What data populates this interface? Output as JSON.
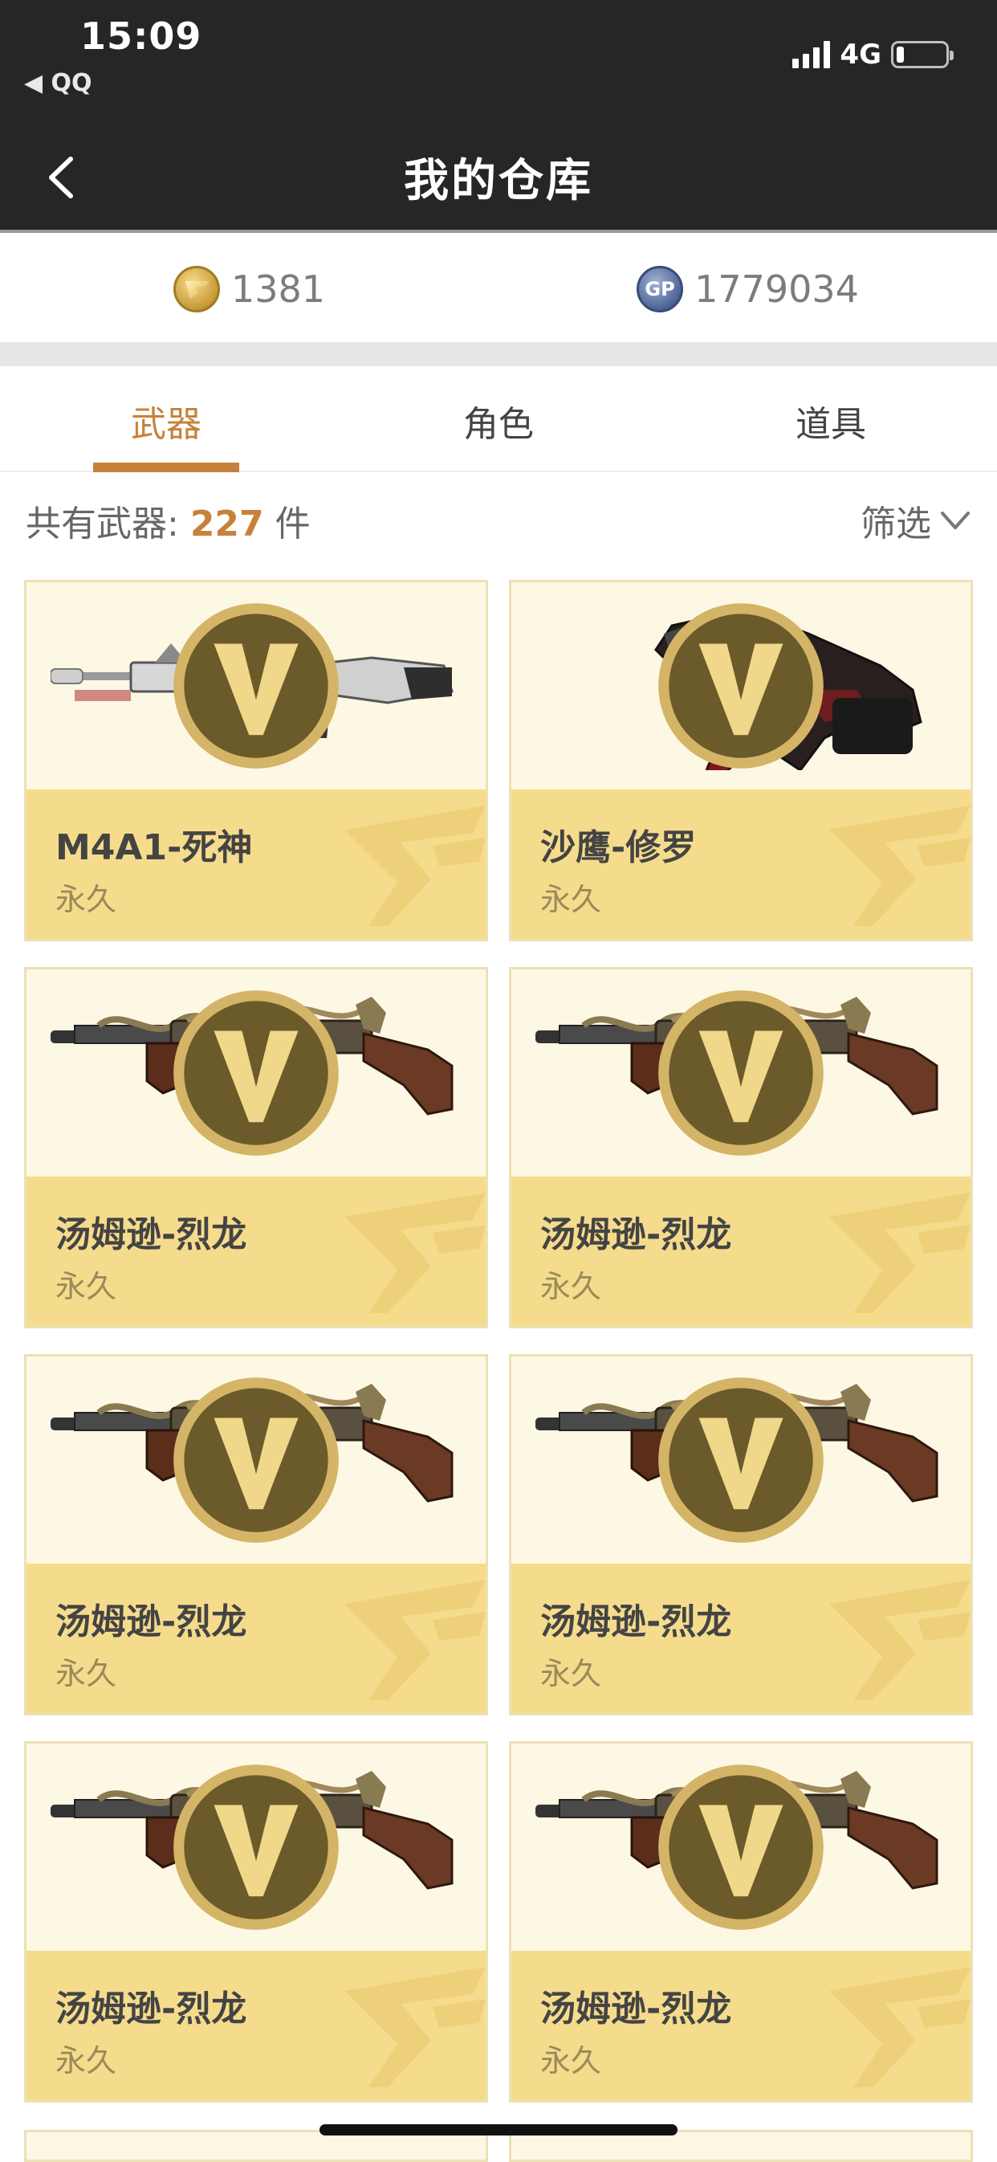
{
  "status_bar": {
    "time": "15:09",
    "back_app": "◀ QQ",
    "network": "4G",
    "signal_bars": 4,
    "battery_level": 0.15
  },
  "nav": {
    "title": "我的仓库",
    "back_icon": "chevron-left-icon"
  },
  "currency": {
    "cf_points": "1381",
    "gp_points": "1779034",
    "cf_icon": "cf-coin-icon",
    "gp_icon": "gp-coin-icon",
    "gp_icon_text": "GP"
  },
  "tabs": [
    {
      "label": "武器",
      "active": true
    },
    {
      "label": "角色",
      "active": false
    },
    {
      "label": "道具",
      "active": false
    }
  ],
  "summary": {
    "prefix": "共有武器: ",
    "count": "227",
    "suffix": " 件",
    "filter_label": "筛选"
  },
  "items": [
    {
      "name": "M4A1-死神",
      "duration": "永久",
      "image": "rifle"
    },
    {
      "name": "沙鹰-修罗",
      "duration": "永久",
      "image": "pistol"
    },
    {
      "name": "汤姆逊-烈龙",
      "duration": "永久",
      "image": "tommy"
    },
    {
      "name": "汤姆逊-烈龙",
      "duration": "永久",
      "image": "tommy"
    },
    {
      "name": "汤姆逊-烈龙",
      "duration": "永久",
      "image": "tommy"
    },
    {
      "name": "汤姆逊-烈龙",
      "duration": "永久",
      "image": "tommy"
    },
    {
      "name": "汤姆逊-烈龙",
      "duration": "永久",
      "image": "tommy"
    },
    {
      "name": "汤姆逊-烈龙",
      "duration": "永久",
      "image": "tommy"
    }
  ],
  "colors": {
    "accent": "#c8813a",
    "header_bg": "#262626",
    "card_bottom": "#f5dc8c",
    "card_top": "#fdf8e4"
  }
}
